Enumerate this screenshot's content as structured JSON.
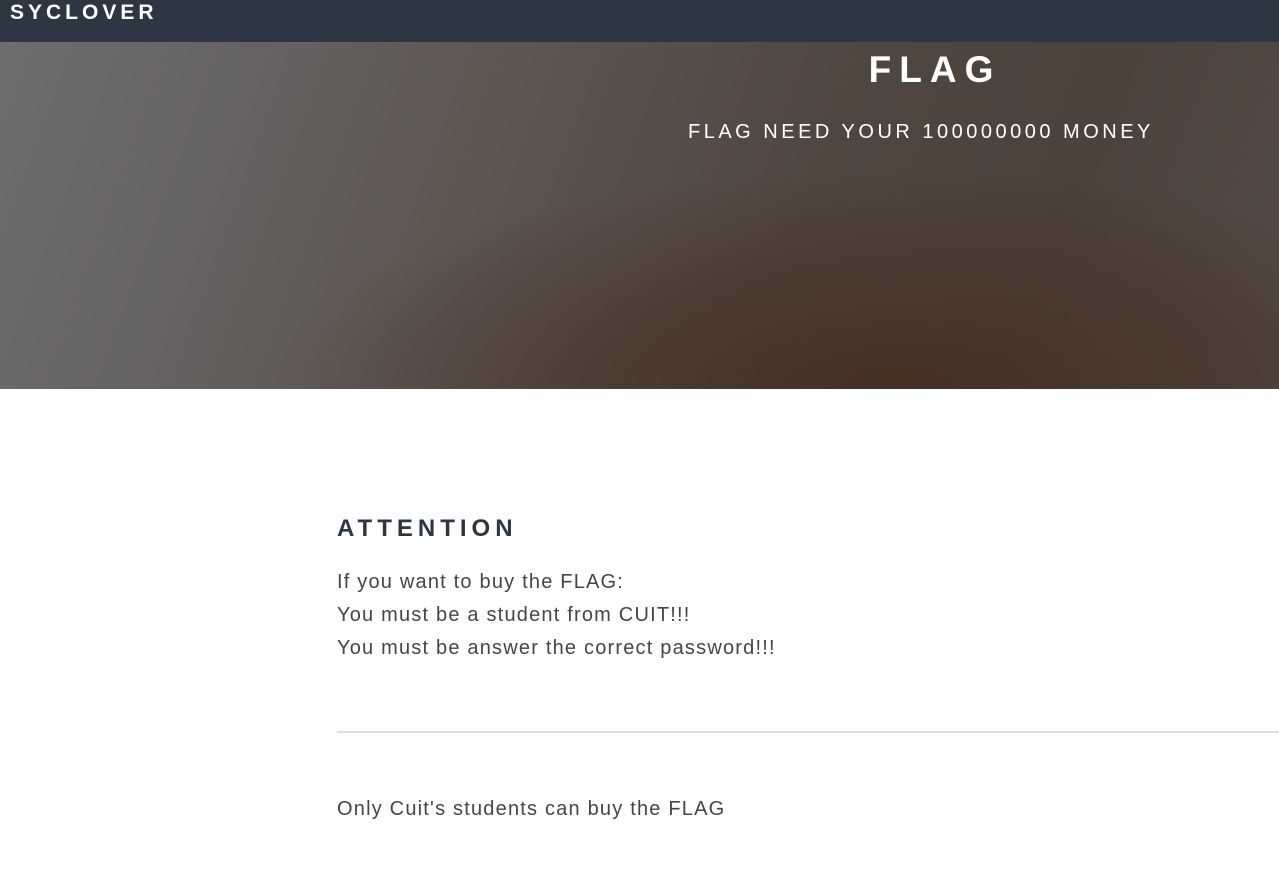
{
  "header": {
    "brand": "SYCLOVER"
  },
  "hero": {
    "title": "FLAG",
    "subtitle": "FLAG NEED YOUR 100000000 MONEY"
  },
  "main": {
    "heading": "ATTENTION",
    "lines": [
      "If you want to buy the FLAG:",
      "You must be a student from CUIT!!!",
      "You must be answer the correct password!!!"
    ],
    "footer_note": "Only Cuit's students can buy the FLAG"
  },
  "colors": {
    "topbar": "#2c3743",
    "heading": "#2c3743",
    "body_text": "#4a4346",
    "divider": "#e0e0e0"
  }
}
